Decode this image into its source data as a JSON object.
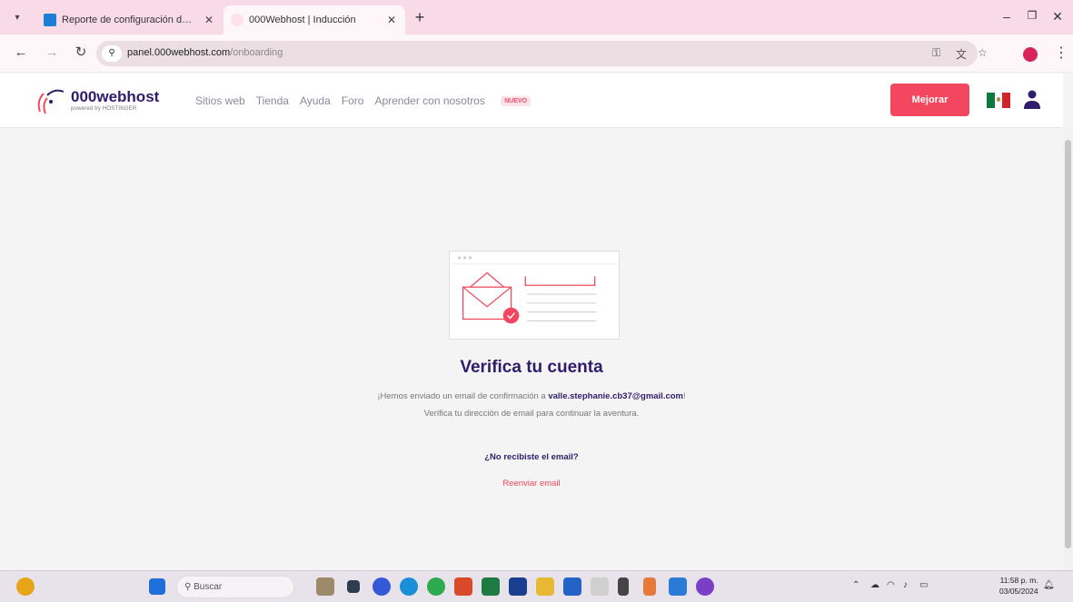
{
  "browser": {
    "tabs": [
      {
        "title": "Reporte de configuración de ..."
      },
      {
        "title": "000Webhost | Inducción"
      }
    ],
    "url_host": "panel.000webhost.com",
    "url_path": "/onboarding"
  },
  "site": {
    "logo_name": "000webhost",
    "logo_sub": "powered by HOSTINGER",
    "nav": [
      "Sitios web",
      "Tienda",
      "Ayuda",
      "Foro",
      "Aprender con nosotros"
    ],
    "nav_badge": "NUEVO",
    "upgrade_label": "Mejorar"
  },
  "main": {
    "title": "Verifica tu cuenta",
    "line1_prefix": "¡Hemos enviado un email de confirmación a ",
    "email": "valle.stephanie.cb37@gmail.com",
    "line1_suffix": "!",
    "line2": "Verifica tu dirección de email para continuar la aventura.",
    "no_email": "¿No recibiste el email?",
    "resend": "Reenviar email"
  },
  "taskbar": {
    "search_placeholder": "Buscar",
    "time": "11:58 p. m.",
    "date": "03/05/2024"
  },
  "colors": {
    "brand_purple": "#2f1c6a",
    "accent_red": "#f3475f",
    "tab_strip": "#f9dbe8"
  }
}
